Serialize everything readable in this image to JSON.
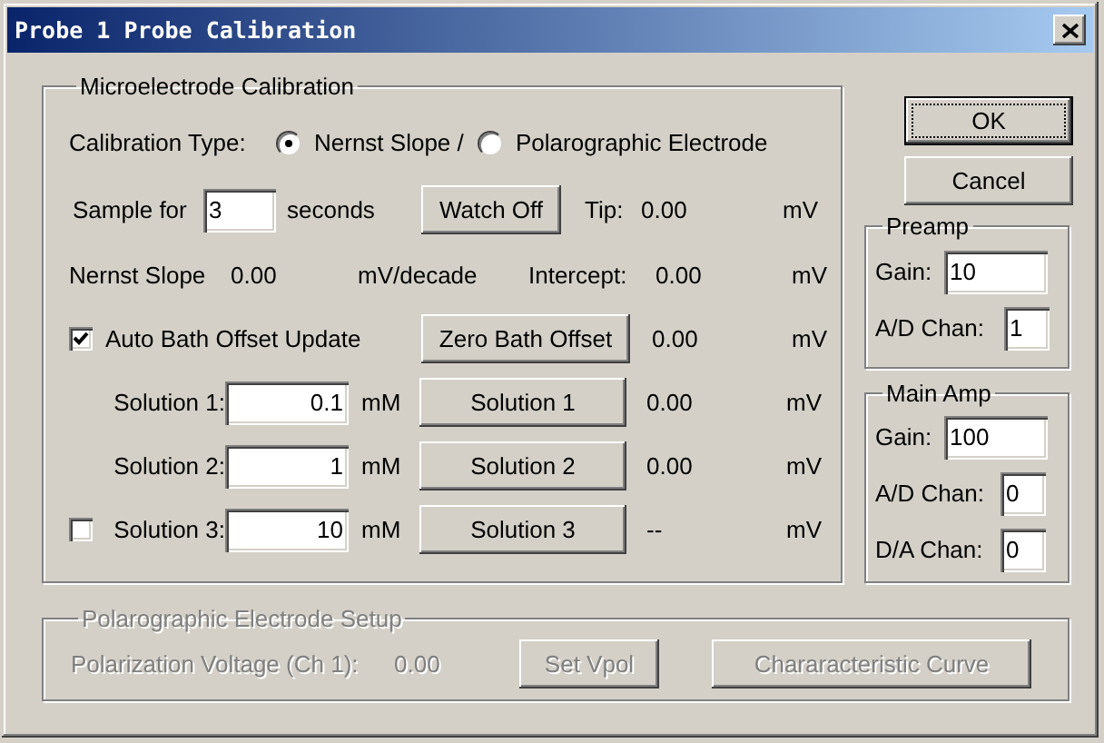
{
  "window": {
    "title": "Probe 1 Probe Calibration"
  },
  "calibration": {
    "title": "Microelectrode Calibration",
    "type_label": "Calibration Type:",
    "types": [
      {
        "label": "Nernst Slope /",
        "selected": true
      },
      {
        "label": "Polarographic Electrode",
        "selected": false
      }
    ],
    "sample": {
      "label": "Sample for",
      "value": "3",
      "unit": "seconds",
      "button": "Watch Off",
      "reading_label": "Tip:",
      "reading": "0.00",
      "reading_unit": "mV"
    },
    "slope": {
      "label": "Nernst Slope",
      "value": "0.00",
      "unit": "mV/decade",
      "intercept_label": "Intercept:",
      "intercept": "0.00",
      "intercept_unit": "mV"
    },
    "bath": {
      "label": "Auto Bath Offset Update",
      "checked": true,
      "button": "Zero Bath Offset",
      "reading": "0.00",
      "unit": "mV"
    },
    "solutions": [
      {
        "kind": "plain",
        "label": "Solution 1:",
        "value": "0.1",
        "unit": "mM",
        "button": "Solution 1",
        "reading": "0.00",
        "reading_unit": "mV"
      },
      {
        "kind": "plain",
        "label": "Solution 2:",
        "value": "1",
        "unit": "mM",
        "button": "Solution 2",
        "reading": "0.00",
        "reading_unit": "mV"
      },
      {
        "kind": "checkable",
        "checked": false,
        "label": "Solution 3:",
        "value": "10",
        "unit": "mM",
        "button": "Solution 3",
        "reading": "--",
        "reading_unit": "mV"
      }
    ]
  },
  "buttons": [
    {
      "label": "OK",
      "default": true
    },
    {
      "label": "Cancel",
      "default": false
    }
  ],
  "preamp": {
    "title": "Preamp",
    "fields": [
      {
        "label": "Gain:",
        "value": "10"
      },
      {
        "label": "A/D Chan:",
        "value": "1"
      }
    ]
  },
  "main_amp": {
    "title": "Main Amp",
    "fields": [
      {
        "label": "Gain:",
        "value": "100"
      },
      {
        "label": "A/D Chan:",
        "value": "0"
      },
      {
        "label": "D/A Chan:",
        "value": "0"
      }
    ]
  },
  "polarographic": {
    "title": "Polarographic Electrode Setup",
    "disabled": true,
    "voltage_label": "Polarization Voltage (Ch 1):",
    "voltage": "0.00",
    "buttons": [
      "Set Vpol",
      "Chararacteristic Curve"
    ]
  }
}
